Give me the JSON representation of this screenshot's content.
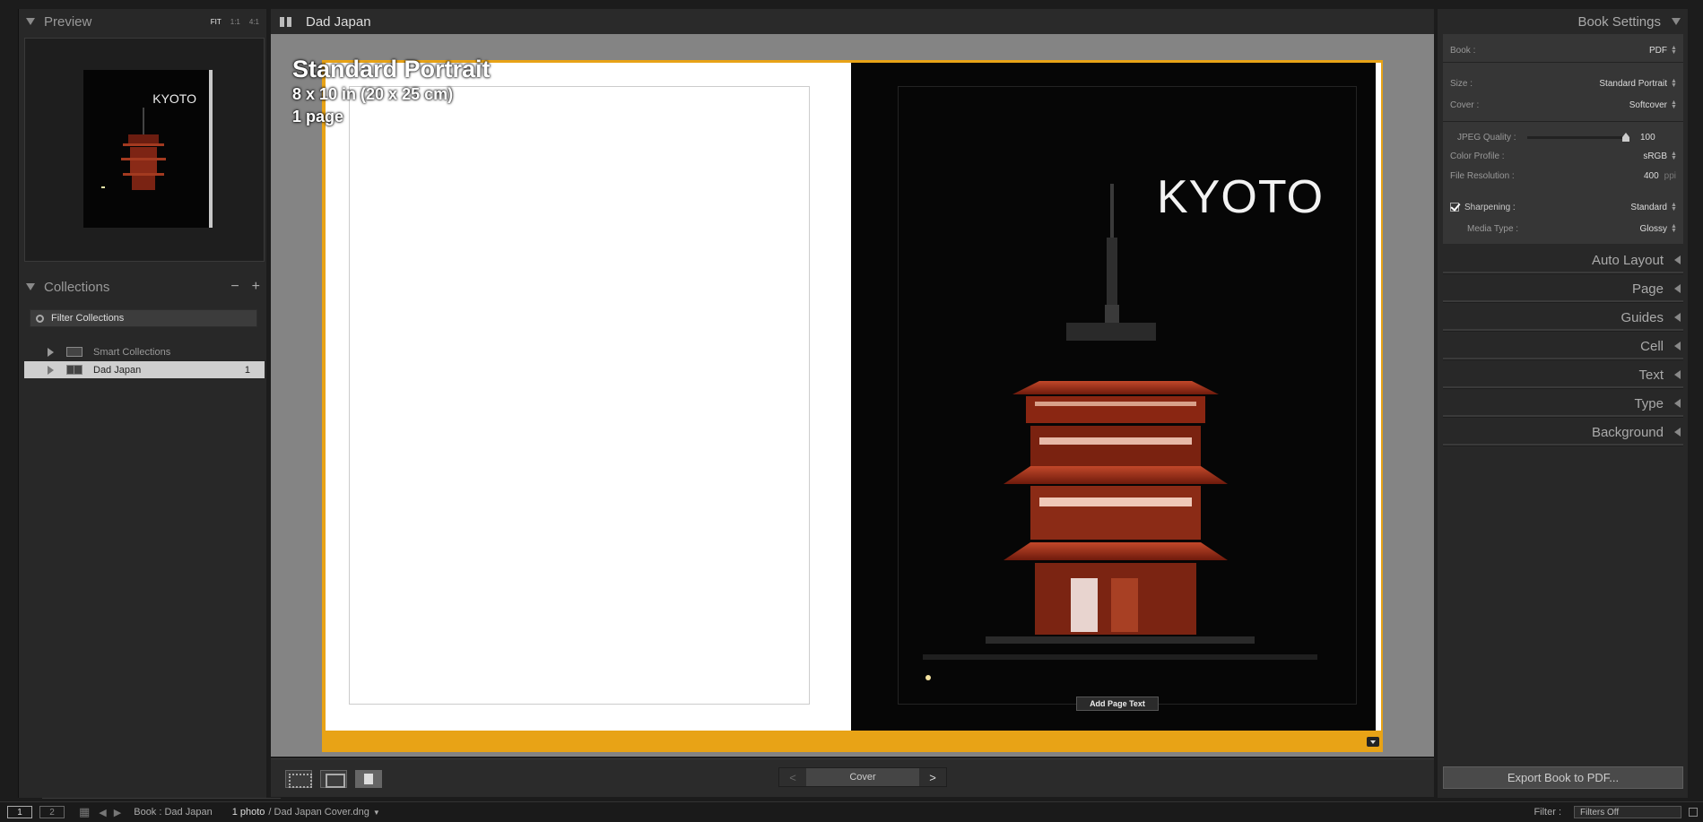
{
  "left_panel": {
    "preview": {
      "title": "Preview",
      "zoom_options": [
        "FIT",
        "1:1",
        "4:1"
      ],
      "thumb_text": "KYOTO"
    },
    "collections": {
      "title": "Collections",
      "remove_label": "−",
      "add_label": "+",
      "filter_placeholder": "Filter Collections",
      "items": [
        {
          "label": "Smart Collections",
          "count": ""
        },
        {
          "label": "Dad Japan",
          "count": "1"
        }
      ]
    }
  },
  "center": {
    "header_title": "Dad Japan",
    "book_info": {
      "title": "Standard Portrait",
      "size": "8 x 10 in (20 x 25 cm)",
      "pages": "1 page"
    },
    "cover_title": "KYOTO",
    "add_page_text": "Add Page Text",
    "page_nav": {
      "prev": "<",
      "label": "Cover",
      "next": ">"
    }
  },
  "right_panel": {
    "book_settings_title": "Book Settings",
    "book": {
      "label": "Book :",
      "value": "PDF"
    },
    "size": {
      "label": "Size :",
      "value": "Standard Portrait"
    },
    "cover": {
      "label": "Cover :",
      "value": "Softcover"
    },
    "jpeg_quality": {
      "label": "JPEG Quality :",
      "value": "100",
      "level": 1.0
    },
    "color_profile": {
      "label": "Color Profile :",
      "value": "sRGB"
    },
    "file_resolution": {
      "label": "File Resolution :",
      "value": "400",
      "unit": "ppi"
    },
    "sharpening": {
      "label": "Sharpening :",
      "value": "Standard",
      "checked": true
    },
    "media_type": {
      "label": "Media Type :",
      "value": "Glossy"
    },
    "sections": [
      "Auto Layout",
      "Page",
      "Guides",
      "Cell",
      "Text",
      "Type",
      "Background"
    ],
    "export_button": "Export Book to PDF..."
  },
  "bottom_bar": {
    "monitor_1": "1",
    "monitor_2": "2",
    "source": "Book : Dad Japan",
    "photo_count": "1 photo",
    "file_name": "/ Dad Japan Cover.dng",
    "filter_label": "Filter :",
    "filter_value": "Filters Off"
  },
  "colors": {
    "spread_highlight": "#e8a316",
    "background": "#848484",
    "panel": "#282828"
  }
}
